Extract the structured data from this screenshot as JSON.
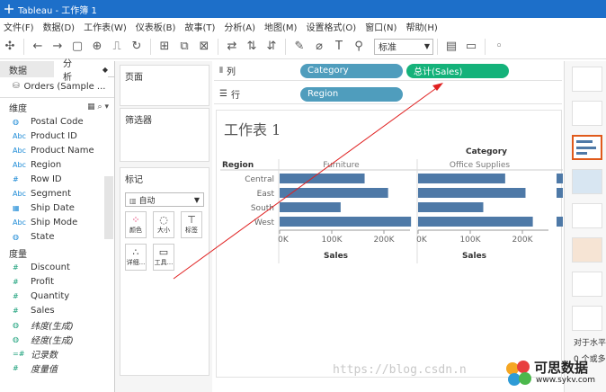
{
  "window": {
    "title": "Tableau - 工作簿 1"
  },
  "menu": [
    "文件(F)",
    "数据(D)",
    "工作表(W)",
    "仪表板(B)",
    "故事(T)",
    "分析(A)",
    "地图(M)",
    "设置格式(O)",
    "窗口(N)",
    "帮助(H)"
  ],
  "toolbar": {
    "fit_select": "标准"
  },
  "datapane": {
    "tabs": [
      "数据",
      "分析"
    ],
    "datasource": "Orders (Sample ...",
    "dimensions_header": "维度",
    "dimensions": [
      {
        "icon": "globe",
        "label": "Postal Code"
      },
      {
        "icon": "Abc",
        "label": "Product ID"
      },
      {
        "icon": "Abc",
        "label": "Product Name"
      },
      {
        "icon": "Abc",
        "label": "Region"
      },
      {
        "icon": "#",
        "label": "Row ID"
      },
      {
        "icon": "Abc",
        "label": "Segment"
      },
      {
        "icon": "calendar",
        "label": "Ship Date"
      },
      {
        "icon": "Abc",
        "label": "Ship Mode"
      },
      {
        "icon": "globe",
        "label": "State"
      }
    ],
    "measures_header": "度量",
    "measures": [
      {
        "icon": "#",
        "label": "Discount",
        "italic": false
      },
      {
        "icon": "#",
        "label": "Profit",
        "italic": false
      },
      {
        "icon": "#",
        "label": "Quantity",
        "italic": false
      },
      {
        "icon": "#",
        "label": "Sales",
        "italic": false
      },
      {
        "icon": "globe",
        "label": "纬度(生成)",
        "italic": true
      },
      {
        "icon": "globe",
        "label": "经度(生成)",
        "italic": true
      },
      {
        "icon": "=#",
        "label": "记录数",
        "italic": true
      },
      {
        "icon": "#",
        "label": "度量值",
        "italic": true
      }
    ]
  },
  "cards": {
    "pages": "页面",
    "filters": "筛选器",
    "marks": "标记",
    "mark_type": "自动",
    "mark_buttons": [
      "颜色",
      "大小",
      "标签",
      "详细...",
      "工具..."
    ]
  },
  "shelves": {
    "columns_label": "列",
    "rows_label": "行",
    "columns_pills": [
      "Category",
      "总计(Sales)"
    ],
    "rows_pills": [
      "Region"
    ]
  },
  "sheet": {
    "title": "工作表 1"
  },
  "chart_data": {
    "type": "bar",
    "column_header": "Category",
    "row_header": "Region",
    "panes": [
      "Furniture",
      "Office Supplies"
    ],
    "categories": [
      "Central",
      "East",
      "South",
      "West"
    ],
    "series": [
      {
        "name": "Furniture",
        "values": [
          163000,
          208000,
          117000,
          252000
        ]
      },
      {
        "name": "Office Supplies",
        "values": [
          167000,
          206000,
          125000,
          220000
        ]
      }
    ],
    "xticks": [
      "0K",
      "100K",
      "200K"
    ],
    "xlabel": "Sales",
    "xlim": [
      0,
      250000
    ],
    "bar_color": "#4e79a7"
  },
  "rightpane": {
    "footer_text_1": "对于水平",
    "footer_text_2": "0 个或多"
  },
  "watermark": "https://blog.csdn.n",
  "logo_text": "可思数据",
  "logo_url": "www.sykv.com",
  "colors": {
    "titlebar": "#1d6fc9",
    "dimension_pill": "#4f9dbd",
    "measure_pill": "#14b27a",
    "bar": "#4e79a7",
    "arrow": "#e02020"
  }
}
